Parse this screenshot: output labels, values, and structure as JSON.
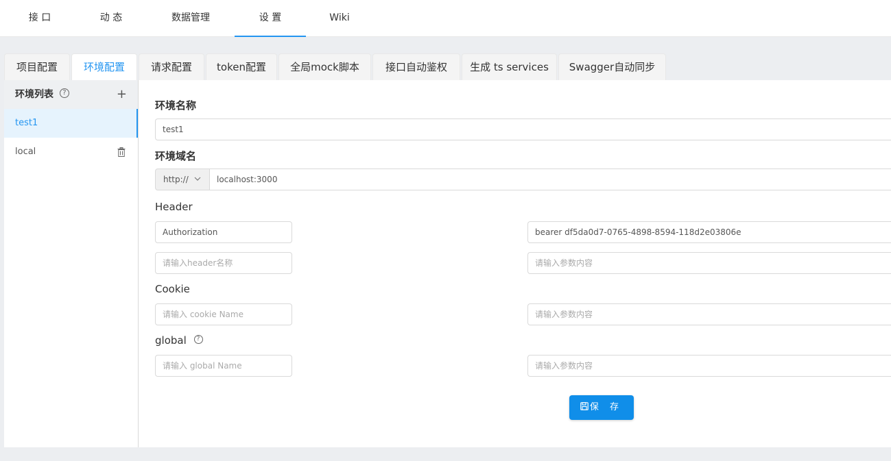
{
  "topnav": {
    "items": [
      {
        "label": "接 口"
      },
      {
        "label": "动 态"
      },
      {
        "label": "数据管理"
      },
      {
        "label": "设 置"
      },
      {
        "label": "Wiki"
      }
    ]
  },
  "tabs": [
    {
      "label": "项目配置"
    },
    {
      "label": "环境配置"
    },
    {
      "label": "请求配置"
    },
    {
      "label": "token配置"
    },
    {
      "label": "全局mock脚本"
    },
    {
      "label": "接口自动鉴权"
    },
    {
      "label": "生成 ts services"
    },
    {
      "label": "Swagger自动同步"
    }
  ],
  "sidebar": {
    "title": "环境列表",
    "help_glyph": "?",
    "add_glyph": "+",
    "items": [
      {
        "label": "test1"
      },
      {
        "label": "local"
      }
    ]
  },
  "form": {
    "env_name_label": "环境名称",
    "env_name_value": "test1",
    "env_domain_label": "环境域名",
    "protocol_value": "http://",
    "domain_value": "localhost:3000",
    "header_label": "Header",
    "header_rows": [
      {
        "name": "Authorization",
        "value": "bearer df5da0d7-0765-4898-8594-118d2e03806e"
      },
      {
        "name_placeholder": "请输入header名称",
        "value_placeholder": "请输入参数内容"
      }
    ],
    "cookie_label": "Cookie",
    "cookie_name_placeholder": "请输入 cookie Name",
    "cookie_value_placeholder": "请输入参数内容",
    "global_label": "global",
    "global_name_placeholder": "请输入 global Name",
    "global_value_placeholder": "请输入参数内容",
    "save_label": "保 存"
  },
  "colors": {
    "accent": "#2395f1",
    "button": "#108ee9"
  }
}
